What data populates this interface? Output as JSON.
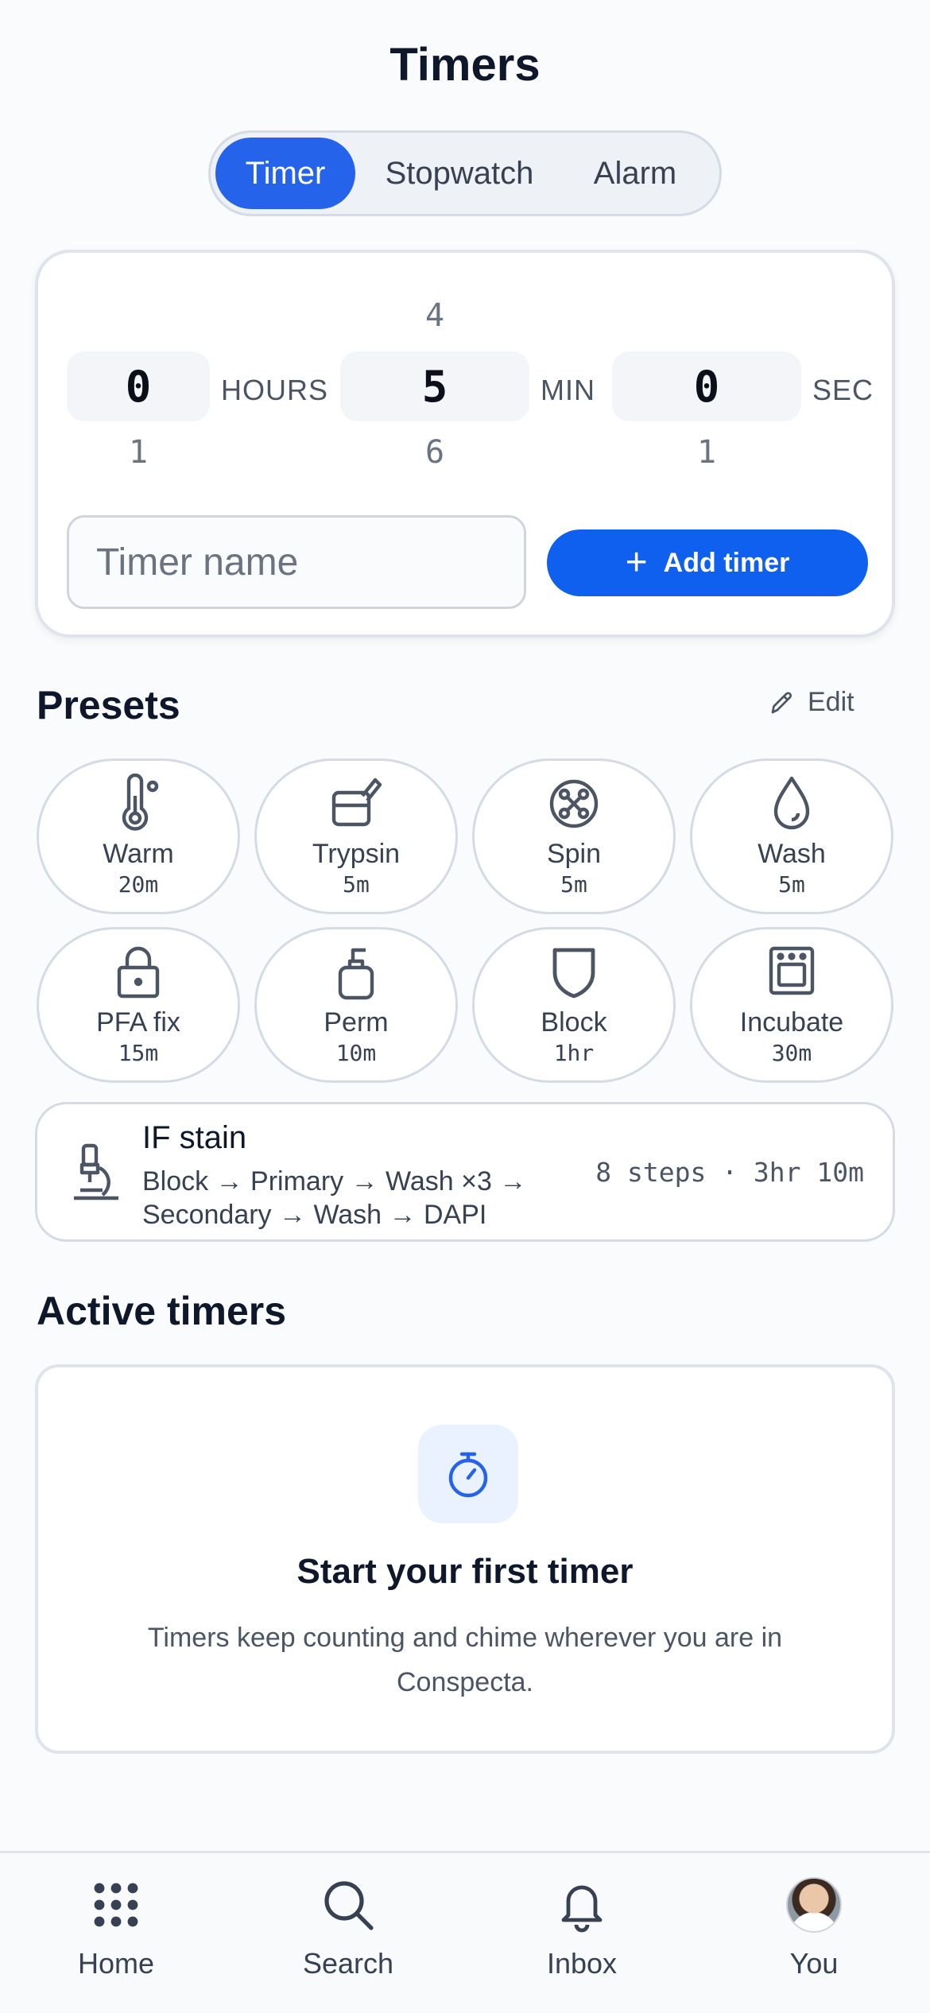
{
  "header": {
    "title": "Timers"
  },
  "segments": {
    "timer": "Timer",
    "stopwatch": "Stopwatch",
    "alarm": "Alarm",
    "selected": "Timer"
  },
  "picker": {
    "hours": {
      "above": "",
      "value": "0",
      "below": "1",
      "unit": "HOURS"
    },
    "minutes": {
      "above": "4",
      "value": "5",
      "below": "6",
      "unit": "MIN"
    },
    "seconds": {
      "above": "",
      "value": "0",
      "below": "1",
      "unit": "SEC"
    },
    "name_placeholder": "Timer name",
    "name_value": "",
    "add_label": "Add timer"
  },
  "presets": {
    "title": "Presets",
    "edit_label": "Edit",
    "items": [
      {
        "name": "Warm",
        "duration": "20m",
        "icon": "thermometer-icon"
      },
      {
        "name": "Trypsin",
        "duration": "5m",
        "icon": "trypsin-icon"
      },
      {
        "name": "Spin",
        "duration": "5m",
        "icon": "centrifuge-icon"
      },
      {
        "name": "Wash",
        "duration": "5m",
        "icon": "droplet-icon"
      },
      {
        "name": "PFA fix",
        "duration": "15m",
        "icon": "lock-icon"
      },
      {
        "name": "Perm",
        "duration": "10m",
        "icon": "dispenser-icon"
      },
      {
        "name": "Block",
        "duration": "1hr",
        "icon": "shield-icon"
      },
      {
        "name": "Incubate",
        "duration": "30m",
        "icon": "incubator-icon"
      }
    ]
  },
  "workflow": {
    "title": "IF stain",
    "steps_line1": "Block → Primary → Wash ×3 →",
    "steps_line2": "Secondary → Wash → DAPI",
    "meta": "8 steps · 3hr 10m",
    "icon": "microscope-icon"
  },
  "active": {
    "title": "Active timers",
    "empty_title": "Start your first timer",
    "empty_desc": "Timers keep counting and chime wherever you are in Conspecta.",
    "icon": "stopwatch-icon"
  },
  "tabbar": {
    "home": "Home",
    "search": "Search",
    "inbox": "Inbox",
    "you": "You"
  },
  "colors": {
    "accent": "#2563eb",
    "button": "#1060f0",
    "background": "#fafbfc"
  }
}
